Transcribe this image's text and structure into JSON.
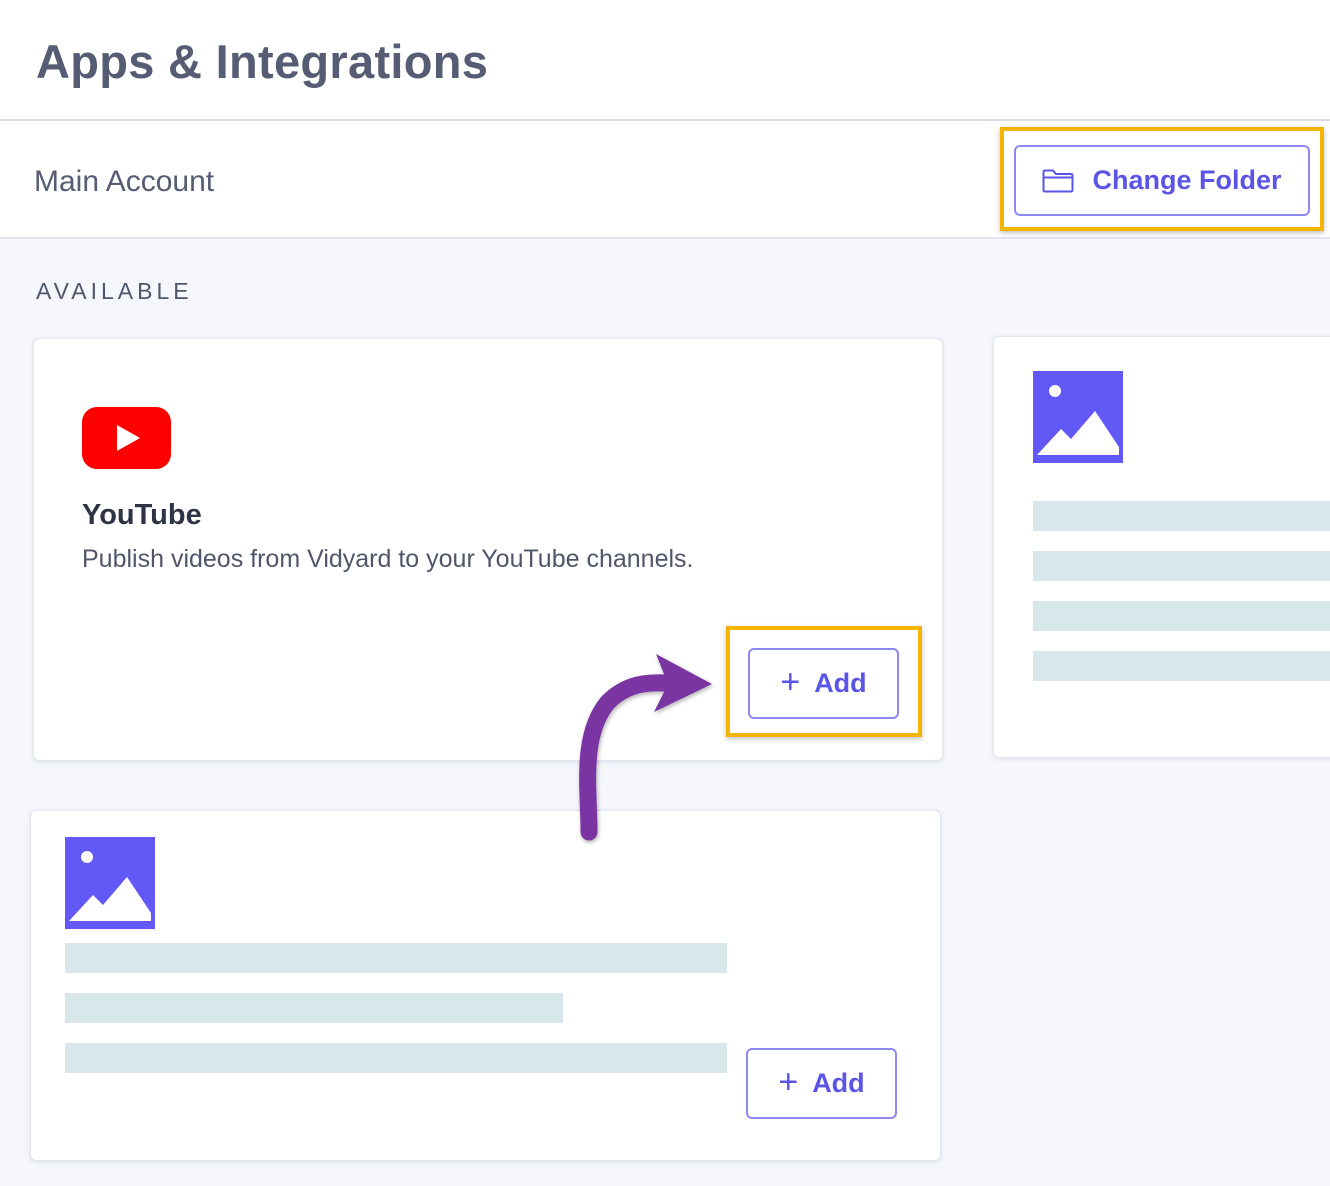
{
  "header": {
    "title": "Apps & Integrations"
  },
  "account": {
    "name": "Main Account",
    "change_folder_label": "Change Folder"
  },
  "section": {
    "label": "AVAILABLE"
  },
  "integrations": [
    {
      "name": "YouTube",
      "description": "Publish videos from Vidyard to your YouTube channels.",
      "add_label": "Add"
    },
    {
      "add_label": "Add"
    }
  ],
  "colors": {
    "accent": "#5a55e6",
    "highlight": "#f5b400",
    "youtube_red": "#ff0000",
    "placeholder_image": "#6258f5",
    "skeleton": "#d8e8ea",
    "annotation_arrow": "#7a35a3"
  },
  "icons": {
    "folder": "folder-icon",
    "plus": "plus-icon",
    "youtube": "youtube-logo",
    "image_placeholder": "image-placeholder-icon"
  }
}
